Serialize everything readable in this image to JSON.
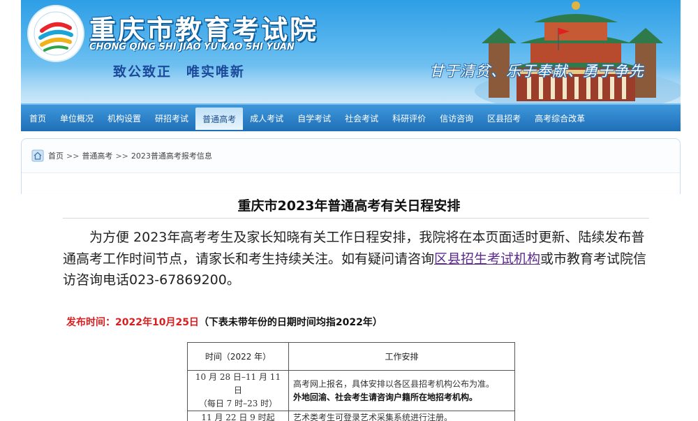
{
  "header": {
    "site_name": "重庆市教育考试院",
    "site_pinyin": "CHONG QING SHI JIAO YU KAO SHI YUAN",
    "motto": "致公致正　唯实唯新",
    "slogan": "甘于清贫、乐于奉献、勇于争先",
    "brand_color": "#2e9ee6"
  },
  "nav": {
    "items": [
      "首页",
      "单位概况",
      "机构设置",
      "研招考试",
      "普通高考",
      "成人考试",
      "自学考试",
      "社会考试",
      "科研评价",
      "信访咨询",
      "区县招考",
      "高考综合改革"
    ],
    "active": "普通高考"
  },
  "breadcrumb": {
    "items": [
      "首页",
      "普通高考",
      "2023普通高考报考信息"
    ],
    "separator": ">>"
  },
  "article": {
    "title": "重庆市2023年普通高考有关日程安排",
    "para_before_link": "为方便 2023年高考考生及家长知晓有关工作日程安排，我院将在本页面适时更新、陆续发布普通高考工作时间节点，请家长和考生持续关注。如有疑问请咨询",
    "link_text": "区县招生考试机构",
    "para_after_link": "或市教育考试院信访咨询电话023-67869200。",
    "pub_label": "发布时间：2022年10月25日",
    "pub_note": "（下表未带年份的日期时间均指2022年）"
  },
  "table": {
    "headers": [
      "时间（2022 年）",
      "工作安排"
    ],
    "rows": [
      {
        "time_lines": [
          "10 月 28 日–11 月 11 日",
          "（每日 7 时–23 时）"
        ],
        "work": "高考网上报名，具体安排以各区县招考机构公布为准。",
        "work_bold": "外地回渝、社会考生请咨询户籍所在地招考机构。"
      },
      {
        "time_lines": [
          "11 月 22 日 9 时起"
        ],
        "work": "艺术类考生可登录艺术采集系统进行注册。",
        "work_bold": ""
      }
    ]
  }
}
